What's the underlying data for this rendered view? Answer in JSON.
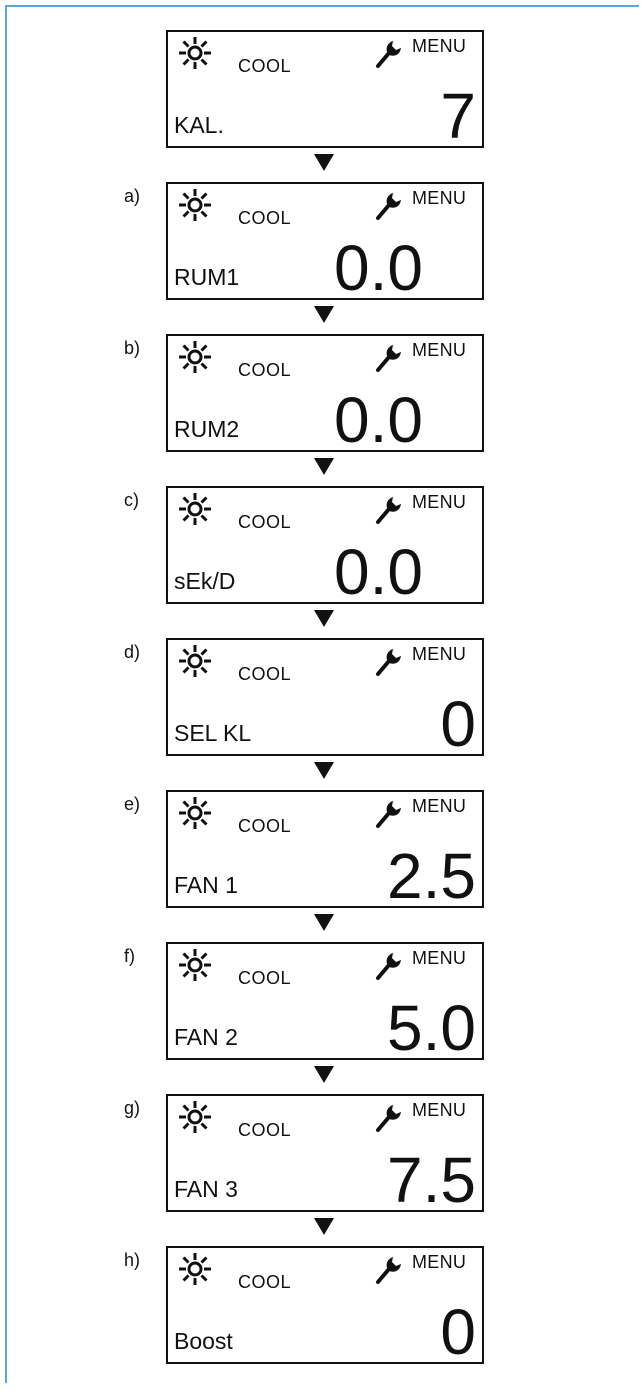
{
  "screens": [
    {
      "label": "",
      "mode": "COOL",
      "menu": "MENU",
      "param": "KAL.",
      "value": "7",
      "align": "right"
    },
    {
      "label": "a)",
      "mode": "COOL",
      "menu": "MENU",
      "param": "RUM1",
      "value": "0.0",
      "align": "center"
    },
    {
      "label": "b)",
      "mode": "COOL",
      "menu": "MENU",
      "param": "RUM2",
      "value": "0.0",
      "align": "center"
    },
    {
      "label": "c)",
      "mode": "COOL",
      "menu": "MENU",
      "param": "sEk/D",
      "value": "0.0",
      "align": "center"
    },
    {
      "label": "d)",
      "mode": "COOL",
      "menu": "MENU",
      "param": "SEL KL",
      "value": "0",
      "align": "right"
    },
    {
      "label": "e)",
      "mode": "COOL",
      "menu": "MENU",
      "param": "FAN 1",
      "value": "2.5",
      "align": "right"
    },
    {
      "label": "f)",
      "mode": "COOL",
      "menu": "MENU",
      "param": "FAN 2",
      "value": "5.0",
      "align": "right"
    },
    {
      "label": "g)",
      "mode": "COOL",
      "menu": "MENU",
      "param": "FAN 3",
      "value": "7.5",
      "align": "right"
    },
    {
      "label": "h)",
      "mode": "COOL",
      "menu": "MENU",
      "param": "Boost",
      "value": "0",
      "align": "right"
    }
  ],
  "icons": {
    "mode_icon": "sun-icon",
    "menu_icon": "wrench-icon",
    "flow_arrow": "down-arrow"
  }
}
